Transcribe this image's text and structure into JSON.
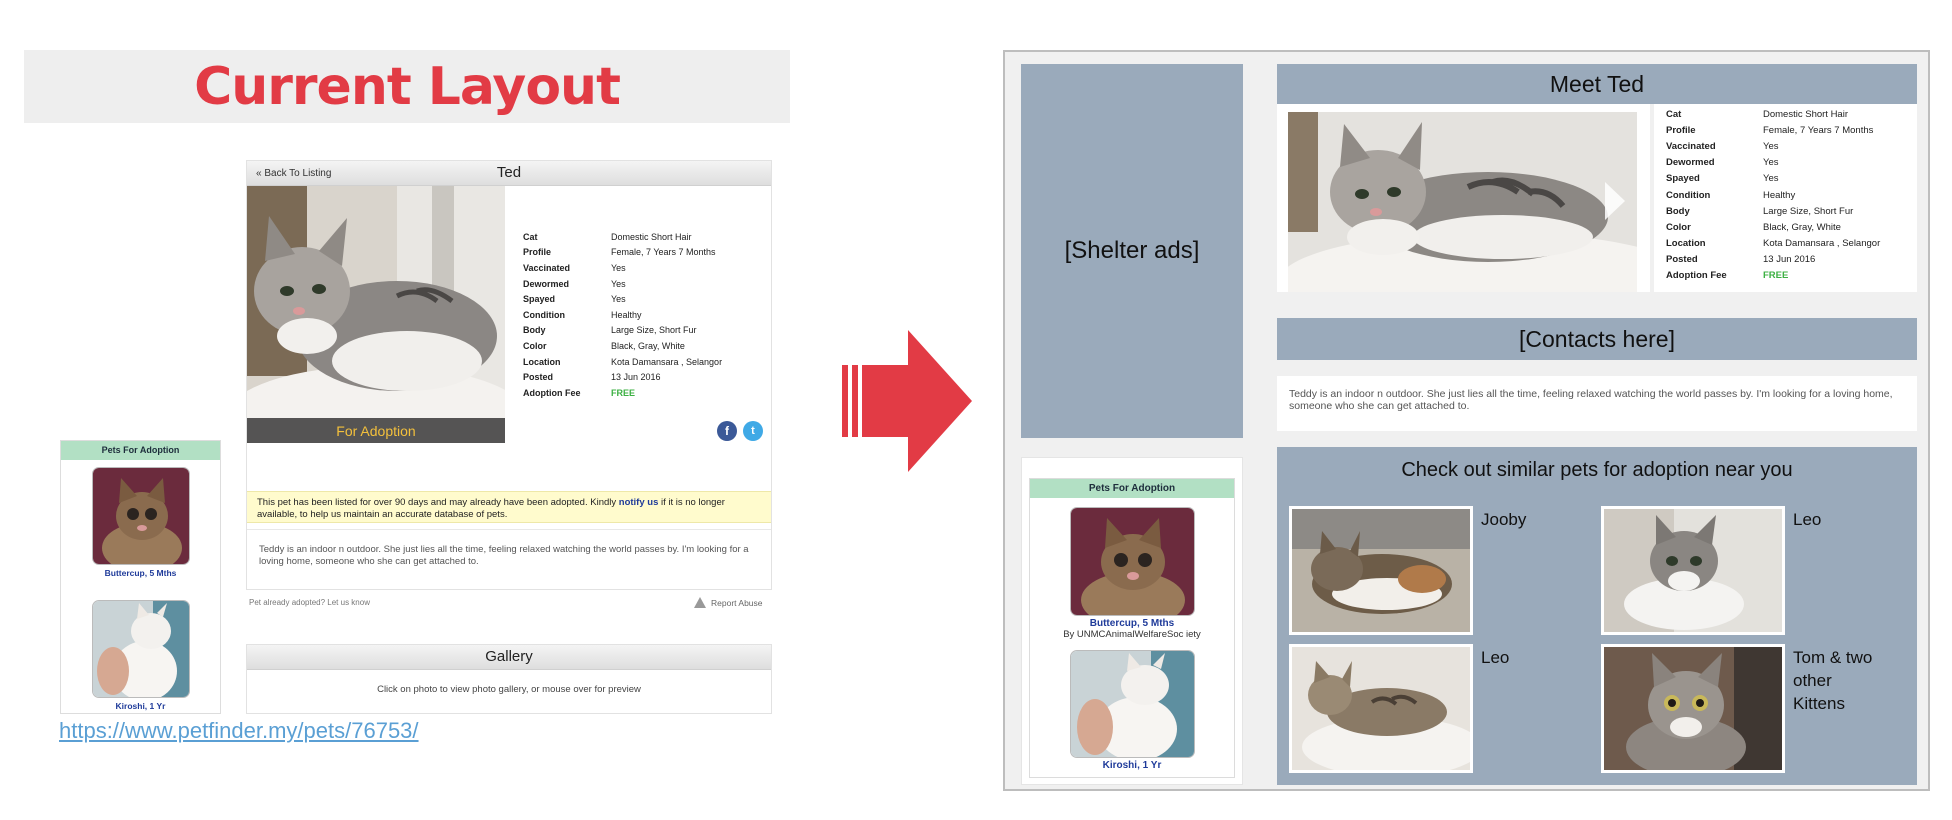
{
  "current_layout": {
    "heading": "Current Layout",
    "listing": {
      "back_link": "« Back To Listing",
      "pet_name": "Ted",
      "photo_banner": "For Adoption",
      "details": [
        {
          "label": "Cat",
          "value": "Domestic Short Hair"
        },
        {
          "label": "Profile",
          "value": "Female, 7 Years 7 Months"
        },
        {
          "label": "Vaccinated",
          "value": "Yes"
        },
        {
          "label": "Dewormed",
          "value": "Yes"
        },
        {
          "label": "Spayed",
          "value": "Yes"
        },
        {
          "label": "Condition",
          "value": "Healthy"
        },
        {
          "label": "Body",
          "value": "Large Size, Short Fur"
        },
        {
          "label": "Color",
          "value": "Black, Gray, White"
        },
        {
          "label": "Location",
          "value": "Kota Damansara , Selangor"
        },
        {
          "label": "Posted",
          "value": "13 Jun 2016"
        },
        {
          "label": "Adoption Fee",
          "value": "FREE"
        }
      ],
      "notice_prefix": "This pet has been listed for over 90 days and may already have been adopted. Kindly ",
      "notice_link": "notify us",
      "notice_suffix": " if it is no longer available, to help us maintain an accurate database of pets.",
      "description": "Teddy is an indoor n outdoor. She just lies all the time, feeling relaxed watching the world passes by. I'm looking for a loving home, someone who she can get attached to.",
      "already_adopted": "Pet already adopted? Let us know",
      "report_abuse": "Report Abuse"
    },
    "gallery": {
      "title": "Gallery",
      "hint": "Click on photo to view photo gallery, or mouse over for preview"
    },
    "sidebar": {
      "title": "Pets For Adoption",
      "items": [
        {
          "name": "Buttercup, 5 Mths"
        },
        {
          "name": "Kiroshi, 1 Yr"
        }
      ]
    },
    "source_url": "https://www.petfinder.my/pets/76753/"
  },
  "proposed_layout": {
    "ads_placeholder": "[Shelter ads]",
    "meet_title": "Meet Ted",
    "details": [
      {
        "label": "Cat",
        "value": "Domestic Short Hair"
      },
      {
        "label": "Profile",
        "value": "Female, 7 Years 7 Months"
      },
      {
        "label": "Vaccinated",
        "value": "Yes"
      },
      {
        "label": "Dewormed",
        "value": "Yes"
      },
      {
        "label": "Spayed",
        "value": "Yes"
      },
      {
        "label": "Condition",
        "value": "Healthy"
      },
      {
        "label": "Body",
        "value": "Large Size, Short Fur"
      },
      {
        "label": "Color",
        "value": "Black, Gray, White"
      },
      {
        "label": "Location",
        "value": "Kota Damansara , Selangor"
      },
      {
        "label": "Posted",
        "value": "13 Jun 2016"
      },
      {
        "label": "Adoption Fee",
        "value": "FREE"
      }
    ],
    "contacts_placeholder": "[Contacts here]",
    "description": "Teddy is an indoor n outdoor. She just lies all the time, feeling relaxed watching the world passes by. I'm looking for a loving home, someone who she can get attached to.",
    "similar_title": "Check out similar pets for adoption near you",
    "similar_pets": [
      {
        "name": "Jooby"
      },
      {
        "name": "Leo"
      },
      {
        "name": "Leo"
      },
      {
        "name": "Tom & two other Kittens"
      }
    ],
    "sidebar": {
      "title": "Pets For Adoption",
      "items": [
        {
          "name": "Buttercup, 5 Mths",
          "by": "By UNMCAnimalWelfareSoc iety"
        },
        {
          "name": "Kiroshi, 1 Yr"
        }
      ]
    }
  },
  "colors": {
    "heading_red": "#e23b45",
    "mockup_slate": "#9aaabb",
    "free_green": "#3cb043",
    "pfa_header_green": "#b2e0c4",
    "banner_yellow": "#f3c03c"
  }
}
